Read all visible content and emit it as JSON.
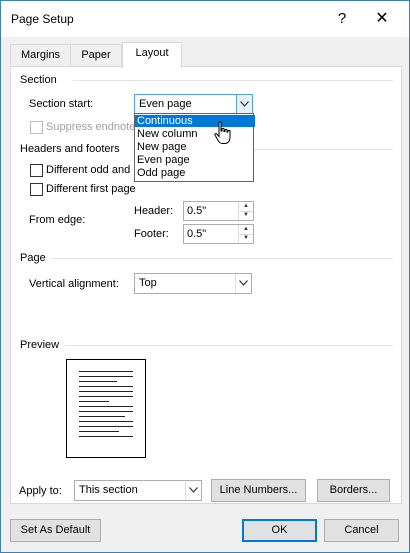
{
  "window": {
    "title": "Page Setup",
    "help_label": "?",
    "close_label": "✕"
  },
  "tabs": [
    {
      "label": "Margins",
      "active": false
    },
    {
      "label": "Paper",
      "active": false
    },
    {
      "label": "Layout",
      "active": true
    }
  ],
  "section": {
    "heading": "Section",
    "start_label": "Section start:",
    "start_value": "Even page",
    "suppress_label": "Suppress endnote",
    "dropdown_options": [
      "Continuous",
      "New column",
      "New page",
      "Even page",
      "Odd page"
    ],
    "dropdown_highlighted": "Continuous"
  },
  "headers_footers": {
    "heading": "Headers and footers",
    "diff_odd_even_label": "Different odd and",
    "diff_first_label": "Different first page",
    "from_edge_label": "From edge:",
    "header_label": "Header:",
    "header_value": "0.5\"",
    "footer_label": "Footer:",
    "footer_value": "0.5\""
  },
  "page": {
    "heading": "Page",
    "valign_label": "Vertical alignment:",
    "valign_value": "Top"
  },
  "preview": {
    "heading": "Preview"
  },
  "apply": {
    "label": "Apply to:",
    "value": "This section",
    "line_numbers_label": "Line Numbers...",
    "borders_label": "Borders..."
  },
  "footer": {
    "set_default_label": "Set As Default",
    "ok_label": "OK",
    "cancel_label": "Cancel"
  },
  "colors": {
    "accent": "#0078d7",
    "window_border": "#3c7fb1",
    "panel_bg": "#ffffff",
    "dialog_bg": "#f0f0f0"
  },
  "icons": {
    "help": "question-mark-icon",
    "close": "close-icon",
    "dropdown": "chevron-down-icon",
    "spin_up": "spin-up-icon",
    "spin_down": "spin-down-icon",
    "cursor": "hand-pointer-icon"
  }
}
